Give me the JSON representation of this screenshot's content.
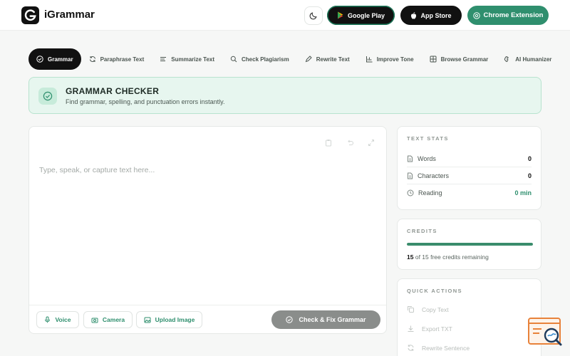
{
  "header": {
    "brand": "iGrammar",
    "google_play": "Google Play",
    "app_store": "App Store",
    "chrome_extension": "Chrome Extension"
  },
  "tabs": [
    {
      "label": "Grammar",
      "icon": "check-circle-icon",
      "active": true
    },
    {
      "label": "Paraphrase Text",
      "icon": "refresh-icon"
    },
    {
      "label": "Summarize Text",
      "icon": "lines-icon"
    },
    {
      "label": "Check Plagiarism",
      "icon": "search-icon"
    },
    {
      "label": "Rewrite Text",
      "icon": "pencil-icon"
    },
    {
      "label": "Improve Tone",
      "icon": "bar-chart-icon"
    },
    {
      "label": "Browse Grammar",
      "icon": "grid-icon"
    },
    {
      "label": "AI Humanizer",
      "icon": "brain-icon"
    }
  ],
  "banner": {
    "title": "GRAMMAR CHECKER",
    "subtitle": "Find grammar, spelling, and punctuation errors instantly."
  },
  "editor": {
    "placeholder": "Type, speak, or capture text here...",
    "voice": "Voice",
    "camera": "Camera",
    "upload": "Upload Image",
    "check": "Check & Fix Grammar"
  },
  "stats": {
    "title": "TEXT STATS",
    "words_label": "Words",
    "words": "0",
    "chars_label": "Characters",
    "chars": "0",
    "reading_label": "Reading",
    "reading": "0 min"
  },
  "credits": {
    "title": "CREDITS",
    "count": "15",
    "text": "of 15 free credits remaining",
    "fraction": 1.0
  },
  "quick_actions": {
    "title": "QUICK ACTIONS",
    "items": [
      "Copy Text",
      "Export TXT",
      "Rewrite Sentence"
    ]
  },
  "colors": {
    "accent": "#2f8f6e",
    "banner_bg": "#e7f6ef",
    "disabled_button": "#8a8d8b"
  }
}
